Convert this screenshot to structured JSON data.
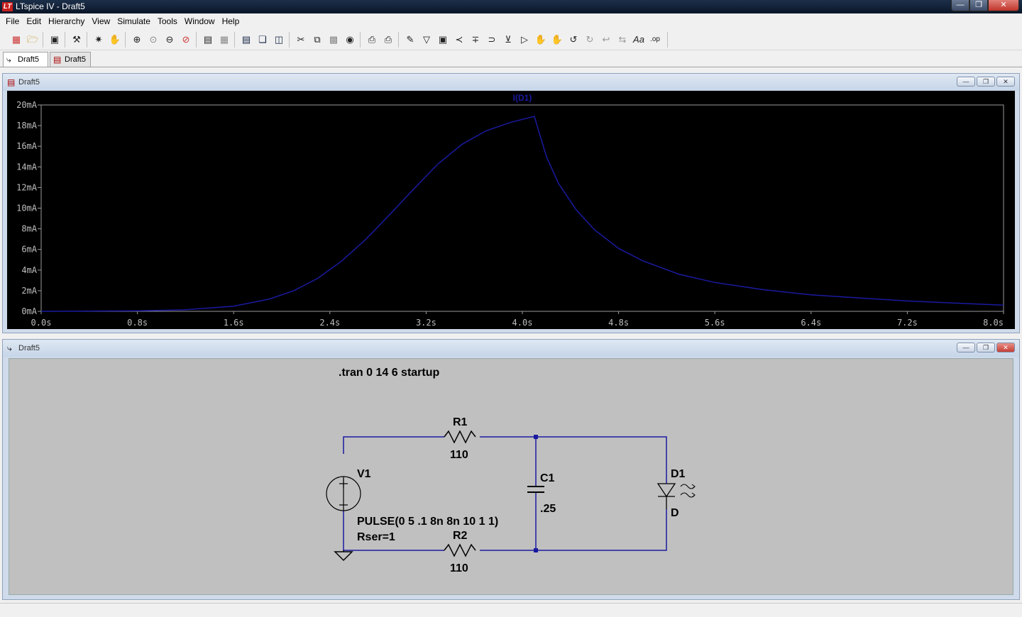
{
  "window": {
    "title": "LTspice IV - Draft5",
    "logo": "LT"
  },
  "menu": [
    "File",
    "Edit",
    "Hierarchy",
    "View",
    "Simulate",
    "Tools",
    "Window",
    "Help"
  ],
  "toolbar_icons": [
    "new-schematic-icon",
    "open-icon",
    "save-icon",
    "control-panel-icon",
    "run-icon",
    "halt-icon",
    "zoom-in-icon",
    "zoom-fit-icon",
    "zoom-out-icon",
    "zoom-cancel-icon",
    "autorange-icon",
    "grid-icon",
    "tile-horizontal-icon",
    "cascade-icon",
    "tile-vertical-icon",
    "cut-icon",
    "copy-icon",
    "paste-icon",
    "find-icon",
    "print-setup-icon",
    "print-icon",
    "draw-wire-icon",
    "ground-icon",
    "label-net-icon",
    "resistor-icon",
    "capacitor-icon",
    "inductor-icon",
    "diode-icon",
    "component-icon",
    "move-icon",
    "drag-icon",
    "undo-icon",
    "redo-icon",
    "rotate-icon",
    "mirror-icon",
    "text-icon",
    "spice-directive-icon"
  ],
  "tabs": [
    {
      "label": "Draft5",
      "icon": "schematic-icon",
      "active": true
    },
    {
      "label": "Draft5",
      "icon": "waveform-icon",
      "active": false
    }
  ],
  "plot_window": {
    "title": "Draft5",
    "icon": "waveform-icon"
  },
  "schematic_window": {
    "title": "Draft5",
    "icon": "schematic-icon"
  },
  "chart_data": {
    "type": "line",
    "title": "I(D1)",
    "xlabel": "",
    "ylabel": "",
    "xlim": [
      0,
      8
    ],
    "ylim": [
      0,
      20
    ],
    "x_ticks": [
      "0.0s",
      "0.8s",
      "1.6s",
      "2.4s",
      "3.2s",
      "4.0s",
      "4.8s",
      "5.6s",
      "6.4s",
      "7.2s",
      "8.0s"
    ],
    "y_ticks": [
      "0mA",
      "2mA",
      "4mA",
      "6mA",
      "8mA",
      "10mA",
      "12mA",
      "14mA",
      "16mA",
      "18mA",
      "20mA"
    ],
    "grid": false,
    "line_color": "#1a1aa0",
    "background": "#000000",
    "series": [
      {
        "name": "I(D1)",
        "x": [
          0,
          0.8,
          1.2,
          1.6,
          1.9,
          2.1,
          2.3,
          2.5,
          2.7,
          2.9,
          3.1,
          3.3,
          3.5,
          3.7,
          3.9,
          4.1,
          4.2,
          4.3,
          4.45,
          4.6,
          4.8,
          5.0,
          5.3,
          5.6,
          6.0,
          6.4,
          6.8,
          7.2,
          7.6,
          8.0
        ],
        "y": [
          0,
          0.05,
          0.15,
          0.5,
          1.2,
          2.0,
          3.2,
          4.9,
          7.0,
          9.4,
          11.9,
          14.3,
          16.2,
          17.5,
          18.3,
          18.9,
          15.0,
          12.4,
          9.8,
          7.9,
          6.1,
          4.9,
          3.6,
          2.8,
          2.1,
          1.6,
          1.3,
          1.0,
          0.8,
          0.6
        ]
      }
    ]
  },
  "schematic": {
    "directive": ".tran 0 14 6 startup",
    "r1_name": "R1",
    "r1_value": "110",
    "r2_name": "R2",
    "r2_value": "110",
    "c1_name": "C1",
    "c1_value": ".25",
    "v1_name": "V1",
    "v1_value": "PULSE(0 5 .1 8n 8n 10 1 1)",
    "v1_rser": "Rser=1",
    "d1_name": "D1",
    "d1_model": "D",
    "wire_color": "#1a1aa0",
    "background": "#c0c0c0"
  }
}
